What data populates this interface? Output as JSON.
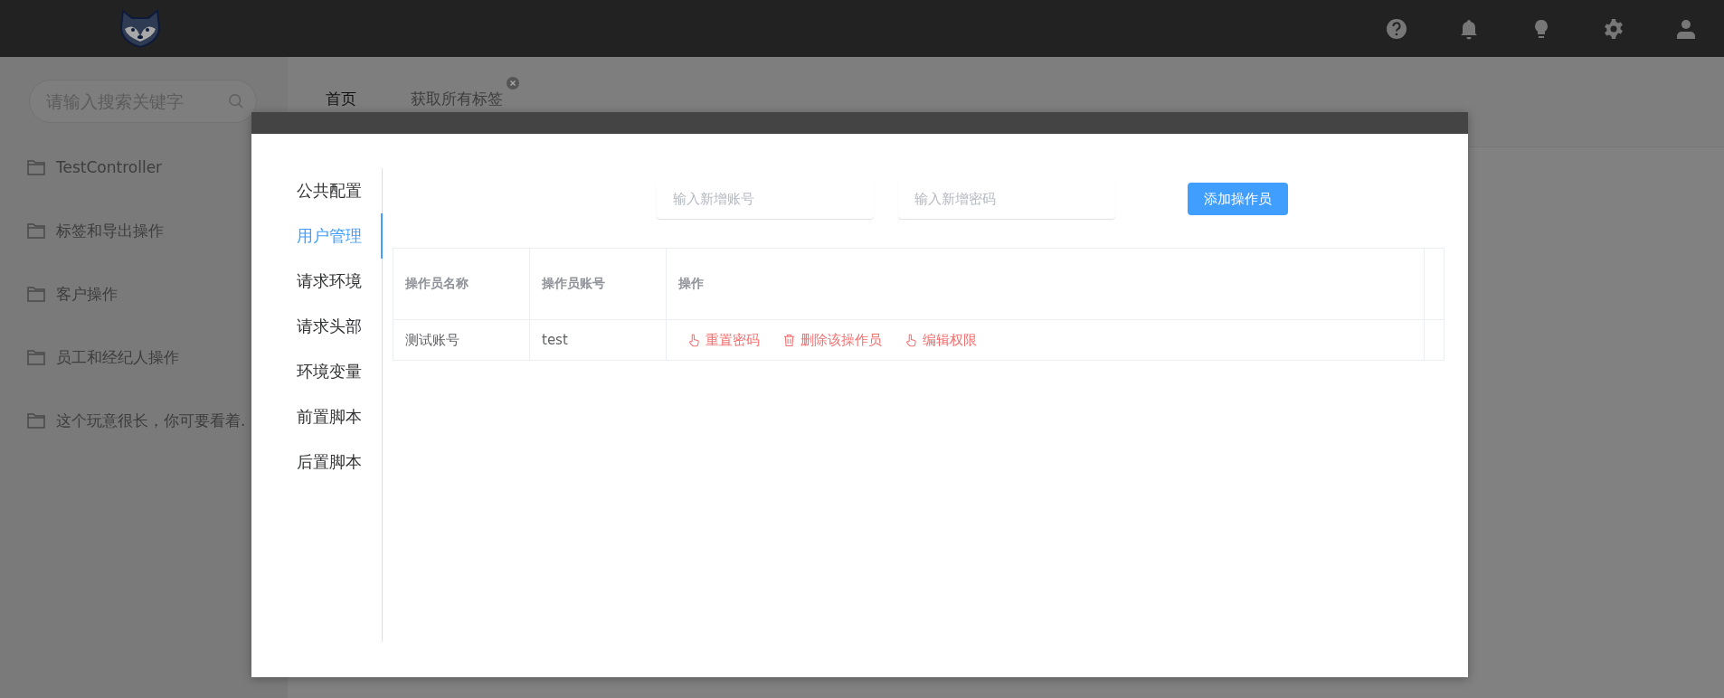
{
  "search": {
    "placeholder": "请输入搜索关键字"
  },
  "sidebar": {
    "items": [
      {
        "label": "TestController"
      },
      {
        "label": "标签和导出操作"
      },
      {
        "label": "客户操作"
      },
      {
        "label": "员工和经纪人操作"
      },
      {
        "label": "这个玩意很长，你可要看着."
      }
    ]
  },
  "tabs": [
    {
      "label": "首页",
      "selected": true,
      "closable": false
    },
    {
      "label": "获取所有标签",
      "selected": false,
      "closable": true
    }
  ],
  "dialog": {
    "nav": [
      {
        "label": "公共配置",
        "selected": false
      },
      {
        "label": "用户管理",
        "selected": true
      },
      {
        "label": "请求环境",
        "selected": false
      },
      {
        "label": "请求头部",
        "selected": false
      },
      {
        "label": "环境变量",
        "selected": false
      },
      {
        "label": "前置脚本",
        "selected": false
      },
      {
        "label": "后置脚本",
        "selected": false
      }
    ],
    "account_field": {
      "placeholder": "输入新增账号"
    },
    "password_field": {
      "placeholder": "输入新增密码"
    },
    "add_button": "添加操作员",
    "table": {
      "columns": [
        "操作员名称",
        "操作员账号",
        "操作"
      ],
      "rows": [
        {
          "name": "测试账号",
          "account": "test",
          "actions": [
            {
              "kind": "hand",
              "label": "重置密码"
            },
            {
              "kind": "trash",
              "label": "删除该操作员"
            },
            {
              "kind": "hand",
              "label": "编辑权限"
            }
          ]
        }
      ]
    }
  }
}
